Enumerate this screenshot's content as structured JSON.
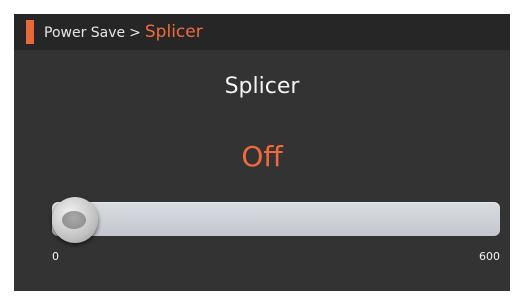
{
  "breadcrumb": {
    "parent": "Power Save",
    "separator": ">",
    "current": "Splicer"
  },
  "setting": {
    "title": "Splicer",
    "value_label": "Off"
  },
  "slider": {
    "min_label": "0",
    "max_label": "600",
    "value": 0
  },
  "colors": {
    "accent": "#f06a3f",
    "background": "#333333",
    "header": "#262626"
  }
}
